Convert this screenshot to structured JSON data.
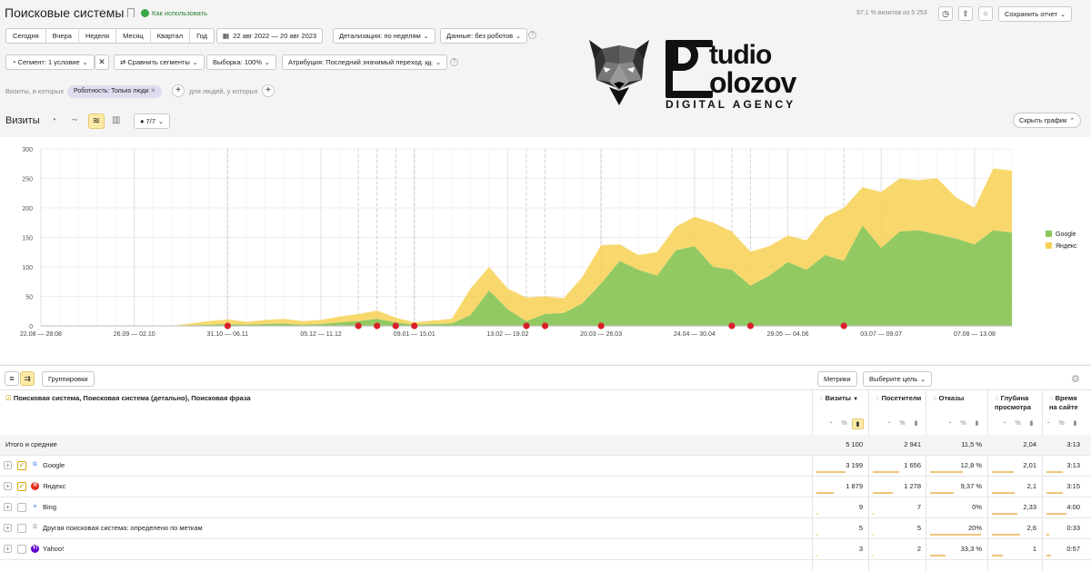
{
  "header": {
    "title": "Поисковые системы",
    "how_to_use": "Как использовать",
    "visits_share": "97,1 % визитов из 5 253",
    "save_report": "Сохранить отчет"
  },
  "period_bar": {
    "buttons": [
      "Сегодня",
      "Вчера",
      "Неделя",
      "Месяц",
      "Квартал",
      "Год"
    ],
    "date_range": "22 авг 2022 — 20 авг 2023",
    "detail": "Детализация: по неделям",
    "data": "Данные: без роботов"
  },
  "segment_bar": {
    "segment": "Сегмент: 1 условие",
    "compare": "Сравнить сегменты",
    "sample": "Выборка: 100%",
    "attribution": "Атрибуция: Последний значимый переход",
    "attribution_badge": "кд"
  },
  "filter_bar": {
    "visits_prefix": "Визиты, в которых",
    "filter_tag": "Роботность: Только люди",
    "people_prefix": "для людей, у которых"
  },
  "logo": {
    "text_top": "tudio",
    "text_bottom": "olozov",
    "tagline": "DIGITAL AGENCY"
  },
  "chart_toolbar": {
    "label": "Визиты",
    "series_count": "7/7",
    "hide_chart": "Скрыть график"
  },
  "colors": {
    "google": "#8cc65a",
    "yandex": "#f7d154",
    "annotation": "#d8202a",
    "accent_bg": "#fdeaa7"
  },
  "chart_data": {
    "type": "area",
    "stacked": true,
    "ylim": [
      0,
      300
    ],
    "yticks": [
      "300",
      "250",
      "200",
      "150",
      "100",
      "50",
      "0"
    ],
    "xtick_labels": [
      "22.08 — 28.08",
      "26.09 — 02.10",
      "31.10 — 06.11",
      "05.12 — 11.12",
      "09.01 — 15.01",
      "13.02 — 19.02",
      "20.03 — 26.03",
      "24.04 — 30.04",
      "29.05 — 04.06",
      "03.07 — 09.07",
      "07.08 — 13.08"
    ],
    "xtick_index": [
      0,
      5,
      10,
      15,
      20,
      25,
      30,
      35,
      40,
      45,
      50
    ],
    "legend": [
      "Google",
      "Яндекс"
    ],
    "series": [
      {
        "name": "Google",
        "values": [
          0,
          0,
          0,
          0,
          0,
          0,
          0,
          0,
          1,
          2,
          3,
          2,
          3,
          4,
          2,
          3,
          6,
          8,
          12,
          6,
          2,
          3,
          4,
          18,
          60,
          28,
          8,
          20,
          22,
          38,
          72,
          110,
          95,
          85,
          128,
          135,
          100,
          95,
          68,
          85,
          108,
          95,
          120,
          110,
          170,
          132,
          160,
          162,
          155,
          148,
          138,
          162,
          158
        ]
      },
      {
        "name": "Яндекс",
        "values": [
          0,
          0,
          0,
          0,
          0,
          0,
          0,
          0,
          3,
          6,
          8,
          5,
          7,
          8,
          6,
          7,
          10,
          12,
          14,
          8,
          4,
          6,
          8,
          45,
          40,
          35,
          40,
          30,
          25,
          45,
          65,
          28,
          25,
          40,
          40,
          50,
          75,
          65,
          58,
          50,
          45,
          50,
          65,
          90,
          65,
          95,
          90,
          85,
          95,
          70,
          62,
          105,
          105
        ]
      },
      {
        "name": "annotations",
        "values": [
          10,
          17,
          18,
          19,
          20,
          26,
          27,
          30,
          37,
          38,
          43
        ]
      }
    ]
  },
  "table": {
    "toolbar": {
      "groupings": "Группировки",
      "metrics": "Метрики",
      "choose_goal": "Выберите цель"
    },
    "dimension_header": "Поисковая система, Поисковая система (детально), Поисковая фраза",
    "columns": [
      {
        "label": "Визиты",
        "sort": "▼"
      },
      {
        "label": "Посетители"
      },
      {
        "label": "Отказы"
      },
      {
        "label": "Глубина просмотра"
      },
      {
        "label": "Время на сайте"
      }
    ],
    "totals": {
      "label": "Итого и средние",
      "values": [
        "5 100",
        "2 941",
        "11,5 %",
        "2,04",
        "3:13"
      ]
    },
    "rows": [
      {
        "name": "Google",
        "icon": "google-icon",
        "checked": true,
        "values": [
          "3 199",
          "1 656",
          "12,8 %",
          "2,01",
          "3:13"
        ],
        "bars": [
          0.63,
          0.56,
          0.64,
          0.5,
          0.5
        ]
      },
      {
        "name": "Яндекс",
        "icon": "yandex-icon",
        "checked": true,
        "values": [
          "1 879",
          "1 278",
          "9,37 %",
          "2,1",
          "3:15"
        ],
        "bars": [
          0.37,
          0.43,
          0.47,
          0.52,
          0.51
        ]
      },
      {
        "name": "Bing",
        "icon": "bing-icon",
        "checked": false,
        "values": [
          "9",
          "7",
          "0%",
          "2,33",
          "4:00"
        ],
        "bars": [
          0.01,
          0.01,
          0,
          0.58,
          0.62
        ]
      },
      {
        "name": "Другая поисковая система: определено по меткам",
        "icon": "other-search-icon",
        "checked": false,
        "values": [
          "5",
          "5",
          "20%",
          "2,6",
          "0:33"
        ],
        "bars": [
          0.01,
          0.01,
          1.0,
          0.65,
          0.09
        ]
      },
      {
        "name": "Yahoo!",
        "icon": "yahoo-icon",
        "checked": false,
        "values": [
          "3",
          "2",
          "33,3 %",
          "1",
          "0:57"
        ],
        "bars": [
          0.01,
          0.01,
          0.3,
          0.25,
          0.15
        ]
      }
    ]
  }
}
